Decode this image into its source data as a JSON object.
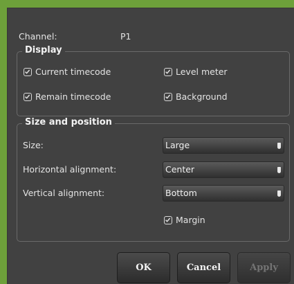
{
  "channel": {
    "label": "Channel:",
    "value": "P1"
  },
  "display": {
    "title": "Display",
    "options": [
      {
        "label": "Current timecode",
        "checked": true
      },
      {
        "label": "Level meter",
        "checked": true
      },
      {
        "label": "Remain timecode",
        "checked": true
      },
      {
        "label": "Background",
        "checked": true
      }
    ]
  },
  "size_position": {
    "title": "Size and position",
    "size_label": "Size:",
    "size_value": "Large",
    "halign_label": "Horizontal alignment:",
    "halign_value": "Center",
    "valign_label": "Vertical alignment:",
    "valign_value": "Bottom",
    "margin": {
      "label": "Margin",
      "checked": true
    }
  },
  "buttons": {
    "ok": "OK",
    "cancel": "Cancel",
    "apply": "Apply",
    "apply_enabled": false
  },
  "colors": {
    "dialog_bg": "#414141",
    "outer_bg": "#6da03a",
    "text": "#e4e4e4",
    "disabled_text": "#747474"
  },
  "icons": {
    "checkbox": "checkmark-icon",
    "dropdown": "dropdown-arrow-icon"
  }
}
